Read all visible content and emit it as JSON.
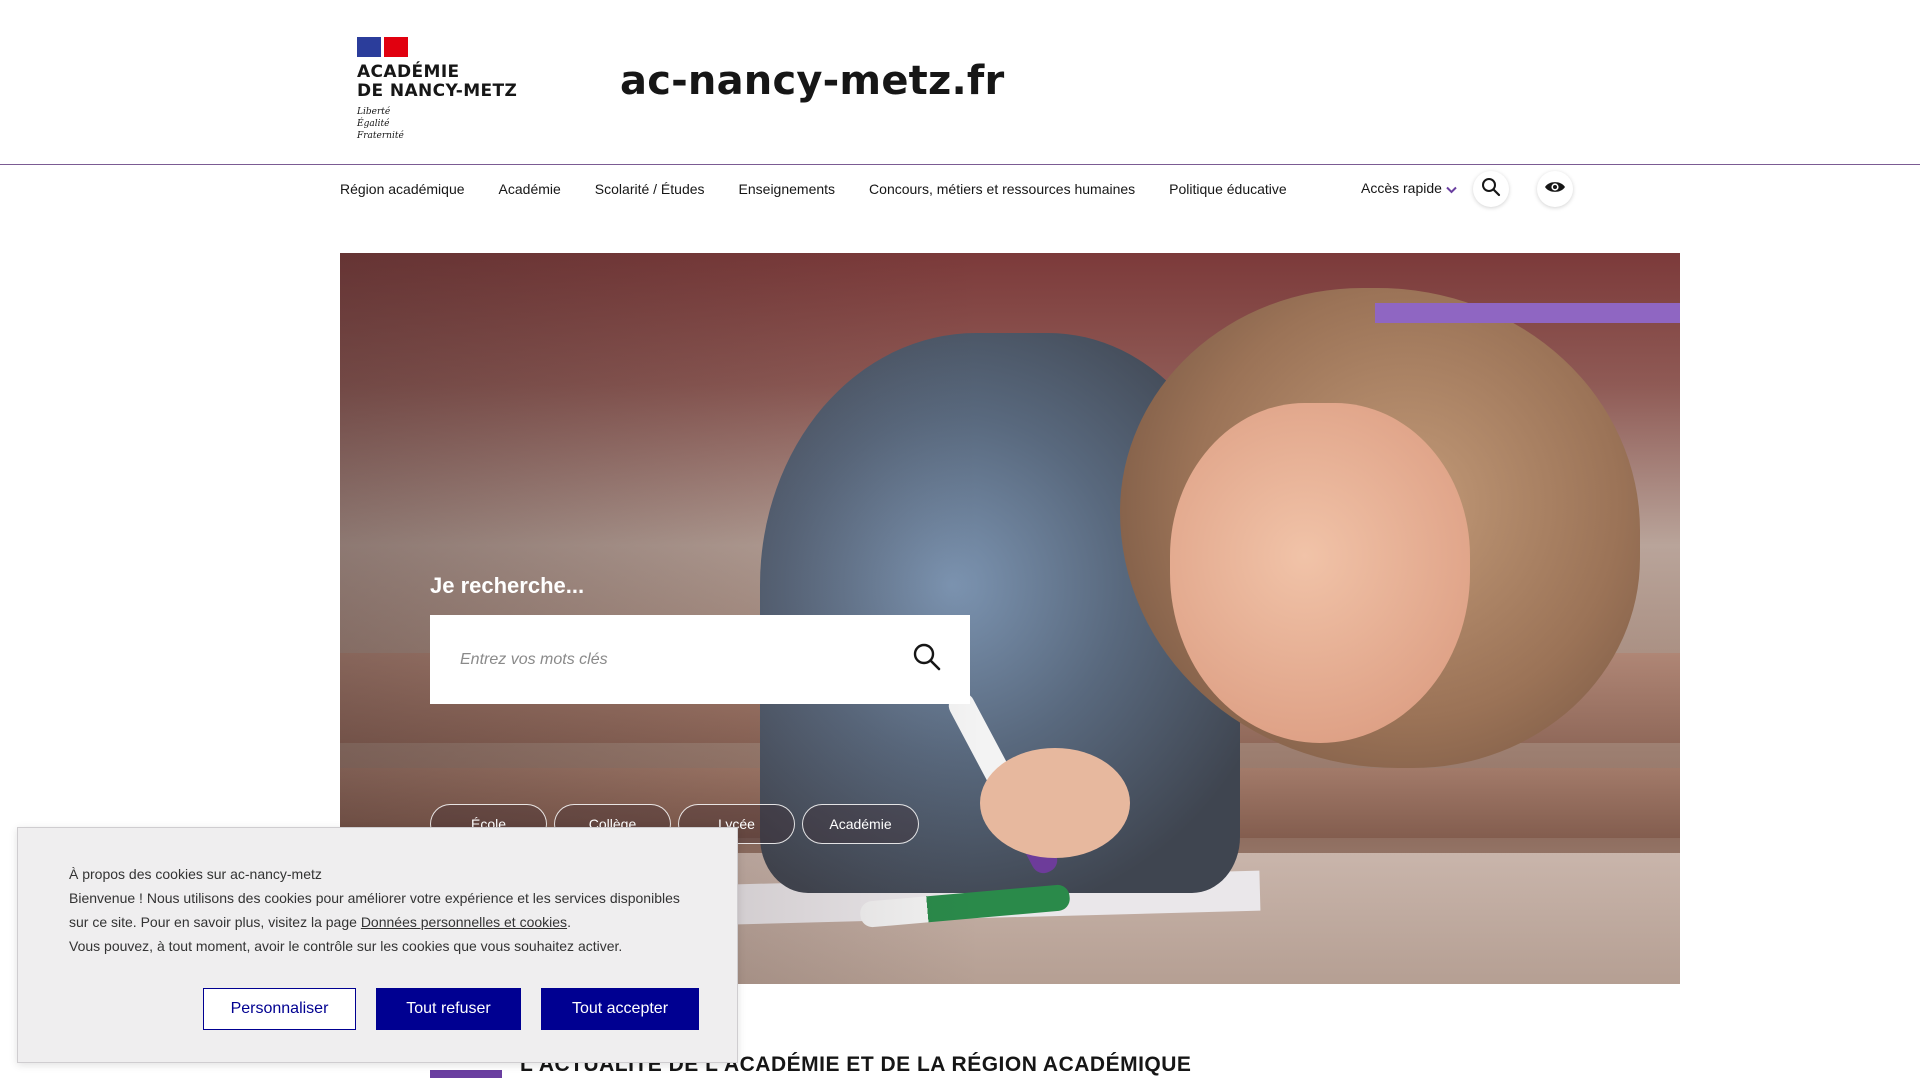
{
  "header": {
    "logo_line1": "ACADÉMIE",
    "logo_line2": "DE NANCY-METZ",
    "motto": [
      "Liberté",
      "Égalité",
      "Fraternité"
    ],
    "site_name": "ac-nancy-metz.fr"
  },
  "nav": {
    "items": [
      {
        "label": "Région académique"
      },
      {
        "label": "Académie"
      },
      {
        "label": "Scolarité / Études"
      },
      {
        "label": "Enseignements"
      },
      {
        "label": "Concours, métiers et ressources humaines"
      },
      {
        "label": "Politique éducative"
      }
    ],
    "quick_access": "Accès rapide",
    "search_icon": "search-icon",
    "eye_icon": "eye-icon"
  },
  "hero": {
    "search_title": "Je recherche...",
    "search_placeholder": "Entrez vos mots clés",
    "pills": [
      {
        "label": "École"
      },
      {
        "label": "Collège"
      },
      {
        "label": "Lycée"
      },
      {
        "label": "Académie"
      }
    ],
    "accent_color": "#8f66c2"
  },
  "section": {
    "title": "L'actualité de l'académie et de la région académique"
  },
  "cookie": {
    "title": "À propos des cookies sur ac-nancy-metz",
    "text_before_link": "Bienvenue ! Nous utilisons des cookies pour améliorer votre expérience et les services disponibles sur ce site. Pour en savoir plus, visitez la page ",
    "link": "Données personnelles et cookies",
    "text_after_link": ".",
    "text2": "Vous pouvez, à tout moment, avoir le contrôle sur les cookies que vous souhaitez activer.",
    "customize": "Personnaliser",
    "refuse": "Tout refuser",
    "accept": "Tout accepter",
    "button_color": "#000091"
  }
}
